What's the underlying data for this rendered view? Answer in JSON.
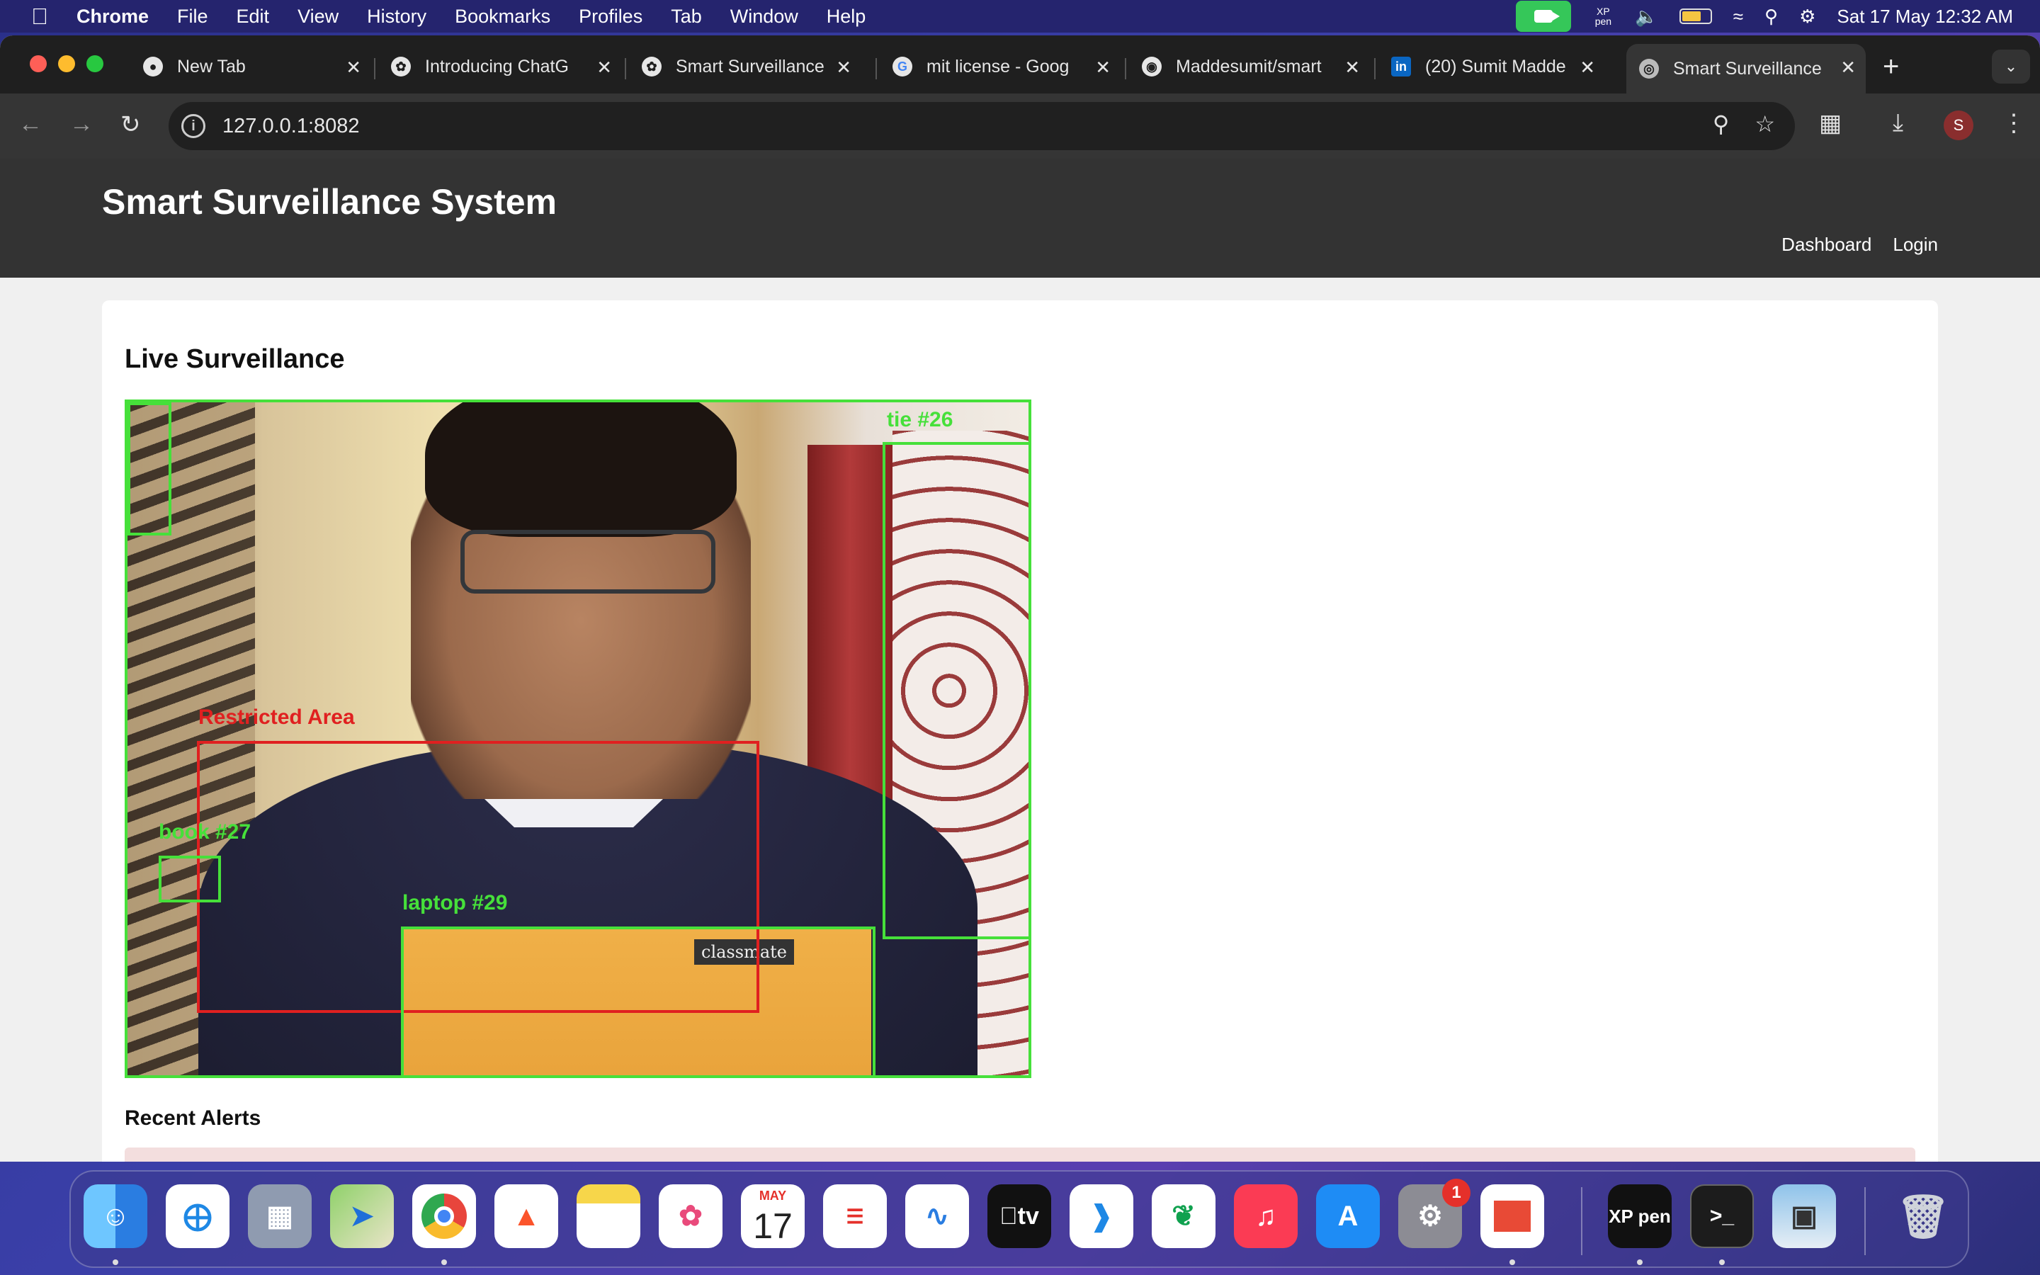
{
  "menubar": {
    "app_name": "Chrome",
    "items": [
      "File",
      "Edit",
      "View",
      "History",
      "Bookmarks",
      "Profiles",
      "Tab",
      "Window",
      "Help"
    ],
    "datetime": "Sat 17 May  12:32 AM",
    "xp_icon_text": "XP pen"
  },
  "tabs": [
    {
      "title": "New Tab",
      "favicon": "chrome-icon"
    },
    {
      "title": "Introducing ChatG",
      "favicon": "openai-icon"
    },
    {
      "title": "Smart Surveillance",
      "favicon": "openai-icon"
    },
    {
      "title": "mit license - Goog",
      "favicon": "google-icon"
    },
    {
      "title": "Maddesumit/smart",
      "favicon": "github-icon"
    },
    {
      "title": "(20) Sumit Madde",
      "favicon": "linkedin-icon"
    },
    {
      "title": "Smart Surveillance",
      "favicon": "globe-icon",
      "active": true
    }
  ],
  "toolbar": {
    "url": "127.0.0.1:8082",
    "profile_initial": "S"
  },
  "site": {
    "title": "Smart Surveillance System",
    "nav": [
      "Dashboard",
      "Login"
    ]
  },
  "main": {
    "section_title": "Live Surveillance",
    "detections": [
      {
        "label": "tie #26",
        "color": "#46e03a"
      },
      {
        "label": "Restricted Area",
        "color": "#e02020"
      },
      {
        "label": "book #27",
        "color": "#46e03a"
      },
      {
        "label": "laptop #29",
        "color": "#46e03a"
      }
    ],
    "notebook_text": "classmate",
    "alerts_title": "Recent Alerts"
  },
  "dock": {
    "calendar_month": "MAY",
    "calendar_day": "17",
    "settings_badge": "1",
    "apps": [
      "Finder",
      "Safari",
      "Launchpad",
      "Maps",
      "Chrome",
      "Brave",
      "Notes",
      "Photos",
      "Calendar",
      "Reminders",
      "Freeform",
      "TV",
      "VS Code",
      "MongoDB Compass",
      "Music",
      "App Store",
      "System Settings",
      "Slides",
      "XP Pen",
      "Terminal",
      "Preview",
      "Trash"
    ],
    "tv_label": "tv",
    "xppen_label": "XP pen",
    "terminal_label": ">_"
  },
  "colors": {
    "detection_green": "#46e03a",
    "restricted_red": "#e02020",
    "header_bg": "#333333"
  }
}
